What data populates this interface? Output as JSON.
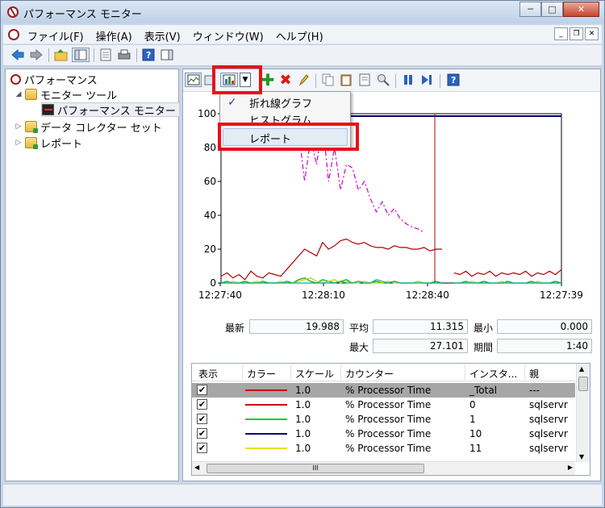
{
  "window": {
    "title": "パフォーマンス モニター",
    "caption_minimize": "─",
    "caption_maximize": "□",
    "caption_close": "✕"
  },
  "menubar": {
    "items": [
      "ファイル(F)",
      "操作(A)",
      "表示(V)",
      "ウィンドウ(W)",
      "ヘルプ(H)"
    ],
    "mdi_minimize": "_",
    "mdi_restore": "❐",
    "mdi_close": "✕"
  },
  "tree": {
    "root": "パフォーマンス",
    "monitor_tools": "モニター ツール",
    "performance_monitor": "パフォーマンス モニター",
    "data_collector_sets": "データ コレクター セット",
    "reports": "レポート"
  },
  "dropdown": {
    "line_graph": "折れ線グラフ",
    "histogram": "ヒストグラム",
    "report": "レポート"
  },
  "chart_data": {
    "type": "line",
    "ylim": [
      0,
      100
    ],
    "yticks": [
      "100",
      "80",
      "60",
      "40",
      "20",
      "0"
    ],
    "xticks": [
      "12:27:40",
      "12:28:10",
      "12:28:40",
      "12:27:39"
    ],
    "series": [
      {
        "color": "#b00000",
        "style": "solid",
        "values": [
          4,
          6,
          3,
          5,
          2,
          7,
          4,
          3,
          6,
          5,
          4,
          8,
          12,
          16,
          20,
          18,
          16,
          24,
          20,
          22,
          25,
          26,
          24,
          23,
          24,
          22,
          21,
          21,
          20,
          22,
          21,
          21,
          20,
          20,
          21,
          19,
          20,
          20,
          null,
          6,
          5,
          7,
          4,
          6,
          5,
          7,
          4,
          6,
          5,
          6,
          5,
          7,
          4,
          6,
          5,
          7,
          5,
          8
        ]
      },
      {
        "color": "#cc00cc",
        "style": "dashdot",
        "values": [
          null,
          null,
          null,
          null,
          null,
          null,
          null,
          null,
          null,
          null,
          null,
          null,
          null,
          90,
          60,
          85,
          70,
          95,
          60,
          80,
          55,
          70,
          68,
          55,
          60,
          50,
          42,
          48,
          40,
          44,
          38,
          35,
          33,
          32,
          30,
          null,
          null,
          null,
          null,
          null,
          null,
          null,
          null,
          null,
          null,
          null,
          null,
          null,
          null,
          null,
          null,
          null,
          null,
          null,
          null,
          null,
          null,
          null
        ]
      },
      {
        "color": "#00aa00",
        "style": "solid",
        "values": [
          0,
          1,
          0,
          0,
          1,
          0,
          0,
          1,
          0,
          0,
          0,
          1,
          0,
          2,
          3,
          1,
          0,
          2,
          1,
          0,
          1,
          2,
          0,
          1,
          0,
          0,
          1,
          0,
          0,
          1,
          0,
          0,
          0,
          1,
          0,
          0,
          1,
          0,
          null,
          0,
          0,
          1,
          0,
          0,
          1,
          0,
          0,
          0,
          1,
          0,
          0,
          0,
          1,
          0,
          0,
          0,
          1,
          0
        ]
      },
      {
        "color": "#cccc00",
        "style": "solid",
        "values": [
          0,
          0,
          1,
          0,
          0,
          0,
          1,
          0,
          0,
          0,
          1,
          0,
          0,
          1,
          2,
          3,
          1,
          0,
          1,
          2,
          0,
          1,
          0,
          0,
          1,
          0,
          0,
          0,
          1,
          0,
          0,
          0,
          0,
          1,
          0,
          0,
          0,
          0,
          null,
          0,
          0,
          0,
          1,
          0,
          0,
          0,
          0,
          1,
          0,
          0,
          0,
          0,
          0,
          1,
          0,
          0,
          0,
          0
        ]
      },
      {
        "color": "#00aaaa",
        "style": "solid",
        "values": [
          0,
          0,
          0,
          0,
          0,
          0,
          0,
          0,
          0,
          0,
          0,
          0,
          0,
          0,
          0,
          0,
          0,
          0,
          0,
          0,
          1,
          0,
          0,
          1,
          0,
          0,
          2,
          1,
          0,
          1,
          0,
          0,
          0,
          0,
          0,
          0,
          0,
          0,
          null,
          0,
          0,
          0,
          0,
          0,
          0,
          0,
          0,
          0,
          0,
          0,
          0,
          0,
          0,
          0,
          0,
          0,
          0,
          0
        ]
      }
    ]
  },
  "stats": {
    "latest_label": "最新",
    "latest_value": "19.988",
    "average_label": "平均",
    "average_value": "11.315",
    "min_label": "最小",
    "min_value": "0.000",
    "max_label": "最大",
    "max_value": "27.101",
    "duration_label": "期間",
    "duration_value": "1:40"
  },
  "counter_table": {
    "headers": [
      "表示",
      "カラー",
      "スケール",
      "カウンター",
      "インスタ...",
      "親"
    ],
    "rows": [
      {
        "color": "#cc0000",
        "scale": "1.0",
        "counter": "% Processor Time",
        "instance": "_Total",
        "parent": "---",
        "selected": true
      },
      {
        "color": "#cc0000",
        "scale": "1.0",
        "counter": "% Processor Time",
        "instance": "0",
        "parent": "sqlservr",
        "selected": false
      },
      {
        "color": "#22cc22",
        "scale": "1.0",
        "counter": "% Processor Time",
        "instance": "1",
        "parent": "sqlservr",
        "selected": false
      },
      {
        "color": "#000080",
        "scale": "1.0",
        "counter": "% Processor Time",
        "instance": "10",
        "parent": "sqlservr",
        "selected": false
      },
      {
        "color": "#e6e600",
        "scale": "1.0",
        "counter": "% Processor Time",
        "instance": "11",
        "parent": "sqlservr",
        "selected": false
      }
    ],
    "check_mark": "✔",
    "hscroll_grip": "III"
  }
}
